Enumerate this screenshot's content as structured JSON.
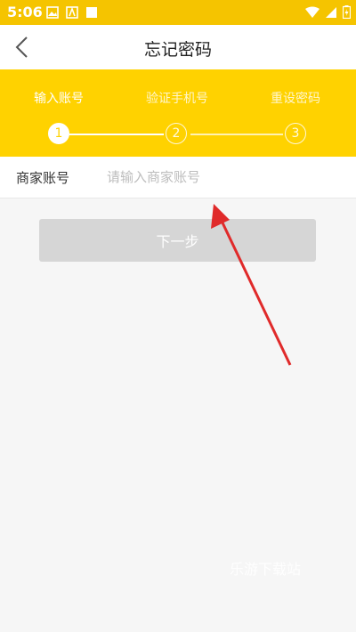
{
  "status_bar": {
    "time": "5:06"
  },
  "nav": {
    "title": "忘记密码"
  },
  "steps": [
    {
      "label": "输入账号",
      "number": "1",
      "active": true
    },
    {
      "label": "验证手机号",
      "number": "2",
      "active": false
    },
    {
      "label": "重设密码",
      "number": "3",
      "active": false
    }
  ],
  "form": {
    "account_label": "商家账号",
    "account_placeholder": "请输入商家账号",
    "account_value": ""
  },
  "next_button": {
    "label": "下一步"
  },
  "watermark": "乐游下载站",
  "colors": {
    "status_bar": "#f5c400",
    "accent": "#ffd200",
    "arrow": "#e02a2a",
    "button_disabled": "#d6d6d6"
  }
}
